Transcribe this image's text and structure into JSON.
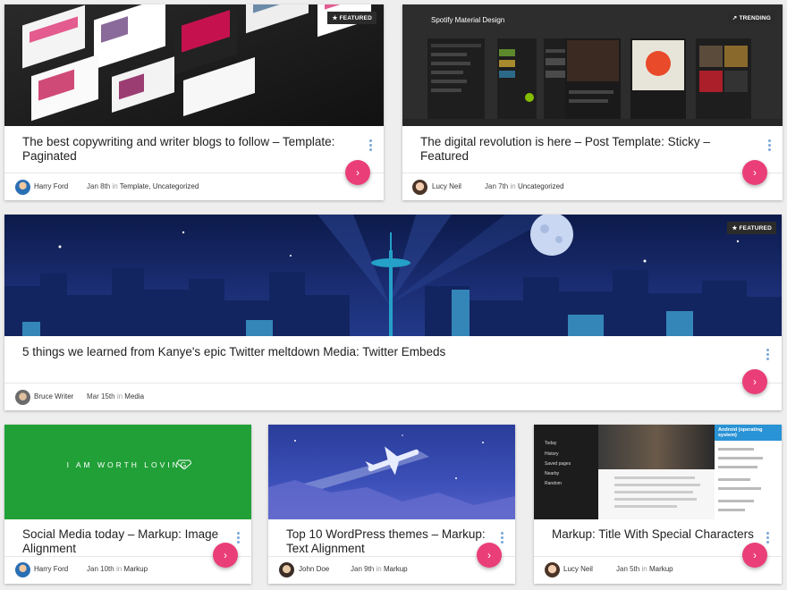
{
  "colors": {
    "accent": "#ea3e79",
    "kebab": "#7aa7d8",
    "green": "#21a038",
    "space": "#1a2a6e"
  },
  "cards": [
    {
      "badge": "★ FEATURED",
      "title": "The best copywriting and writer blogs to follow – Template: Paginated",
      "author": "Harry Ford",
      "date": "Jan 8th",
      "in": "in",
      "categories": "Template, Uncategorized"
    },
    {
      "badge": "↗ TRENDING",
      "thumb_caption": "Spotify Material Design",
      "title": "The digital revolution is here – Post Template: Sticky – Featured",
      "author": "Lucy Neil",
      "date": "Jan 7th",
      "in": "in",
      "categories": "Uncategorized"
    },
    {
      "badge": "★ FEATURED",
      "title": "5 things we learned from Kanye's epic Twitter meltdown Media: Twitter Embeds",
      "author": "Bruce Writer",
      "date": "Mar 15th",
      "in": "in",
      "categories": "Media"
    },
    {
      "thumb_caption": "I AM WORTH LOVING",
      "title": "Social Media today – Markup: Image Alignment",
      "author": "Harry Ford",
      "date": "Jan 10th",
      "in": "in",
      "categories": "Markup"
    },
    {
      "title": "Top 10 WordPress themes – Markup: Text Alignment",
      "author": "John Doe",
      "date": "Jan 9th",
      "in": "in",
      "categories": "Markup"
    },
    {
      "thumb_caption": "Android (operating system)",
      "thumb_menu": [
        "Today",
        "History",
        "Saved pages",
        "Nearby",
        "Random"
      ],
      "title": "Markup: Title With Special Characters",
      "author": "Lucy Neil",
      "date": "Jan 5th",
      "in": "in",
      "categories": "Markup"
    }
  ]
}
